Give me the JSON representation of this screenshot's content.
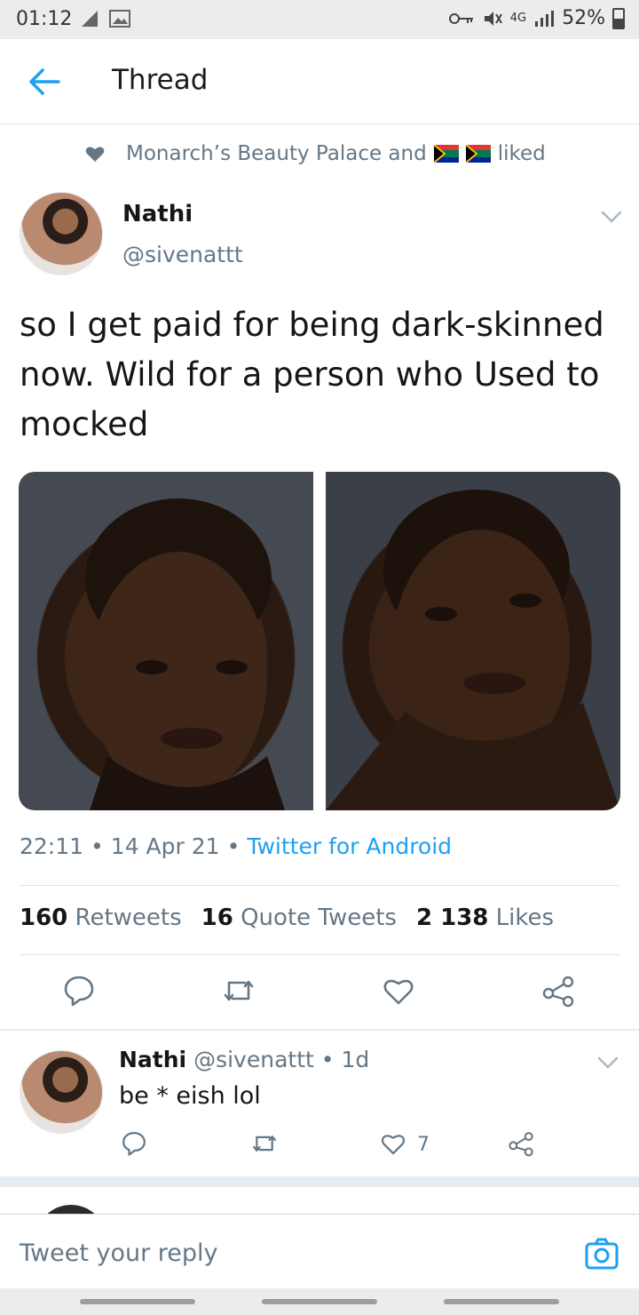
{
  "status_bar": {
    "time": "01:12",
    "network": "4G",
    "battery": "52%"
  },
  "app_bar": {
    "title": "Thread"
  },
  "social_context": {
    "text": "Monarch’s Beauty Palace and",
    "suffix": "liked"
  },
  "tweet": {
    "author_name": "Nathi",
    "author_handle": "@sivenattt",
    "text": "so I get paid for being dark-skinned now. Wild for a person who Used to mocked",
    "time": "22:11",
    "date": "14 Apr 21",
    "source": "Twitter for Android",
    "dot": "•",
    "stats": {
      "retweets_count": "160",
      "retweets_label": "Retweets",
      "quotes_count": "16",
      "quotes_label": "Quote Tweets",
      "likes_count": "2 138",
      "likes_label": "Likes"
    }
  },
  "reply": {
    "author_name": "Nathi",
    "author_handle": "@sivenattt",
    "dot": "•",
    "age": "1d",
    "text": "be * eish lol",
    "like_count": "7"
  },
  "composer": {
    "placeholder": "Tweet your reply"
  },
  "colors": {
    "accent": "#1da1f2",
    "secondary_text": "#657786",
    "divider": "#dfe3e6"
  },
  "icons": [
    "back-arrow-icon",
    "chevron-down-icon",
    "heart-icon",
    "reply-icon",
    "retweet-icon",
    "like-icon",
    "share-icon",
    "camera-icon"
  ]
}
